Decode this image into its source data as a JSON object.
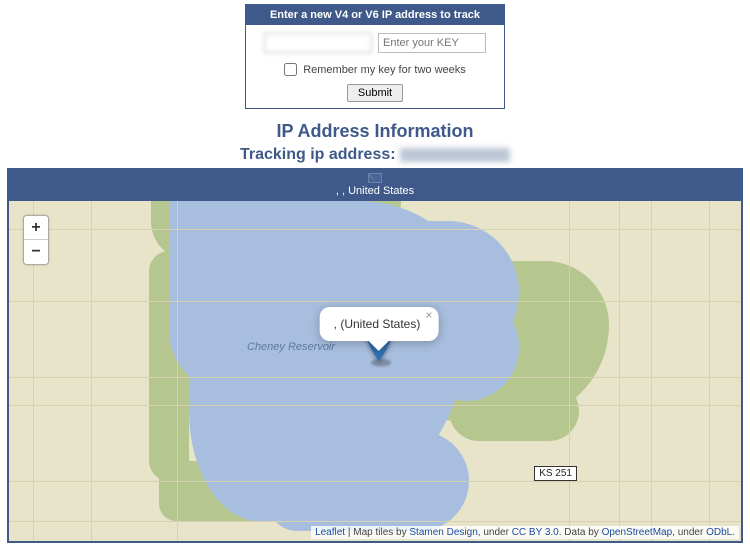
{
  "form": {
    "header": "Enter a new V4 or V6 IP address to track",
    "ip_value": "",
    "key_placeholder": "Enter your KEY",
    "remember_label": "Remember my key for two weeks",
    "submit_label": "Submit"
  },
  "section_title": "IP Address Information",
  "tracking_label": "Tracking ip address:",
  "tracking_ip": "",
  "country_bar": {
    "prefix": ", ,",
    "country": "United States"
  },
  "map": {
    "reservoir_label": "Cheney Reservoir",
    "road_badge": "KS 251",
    "zoom_in": "+",
    "zoom_out": "−",
    "popup_text": ", (United States)",
    "attribution": {
      "leaflet": "Leaflet",
      "sep1": " | Map tiles by ",
      "stamen": "Stamen Design",
      "sep2": ", under ",
      "cc": "CC BY 3.0",
      "sep3": ". Data by ",
      "osm": "OpenStreetMap",
      "sep4": ", under ",
      "odbl": "ODbL",
      "tail": "."
    }
  }
}
